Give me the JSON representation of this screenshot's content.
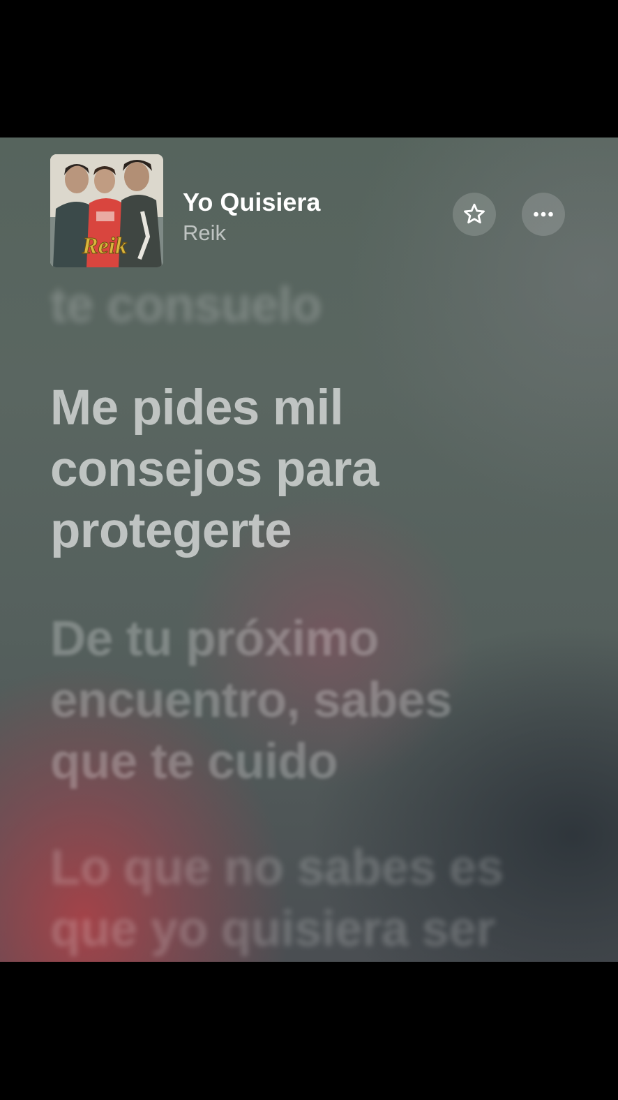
{
  "now_playing": {
    "title": "Yo Quisiera",
    "artist": "Reik",
    "album_art_logo": "Reik"
  },
  "controls": {
    "favorite_icon": "star-icon",
    "more_icon": "ellipsis-icon"
  },
  "lyrics": {
    "previous": "te consuelo",
    "current": "Me pides mil\nconsejos para\nprotegerte",
    "next": "De tu próximo\nencuentro, sabes\nque te cuido",
    "next2": "Lo que no sabes es\nque yo quisiera ser"
  },
  "colors": {
    "background_top": "#56645d",
    "background_accent": "#a84248",
    "text_primary": "#ffffff"
  }
}
